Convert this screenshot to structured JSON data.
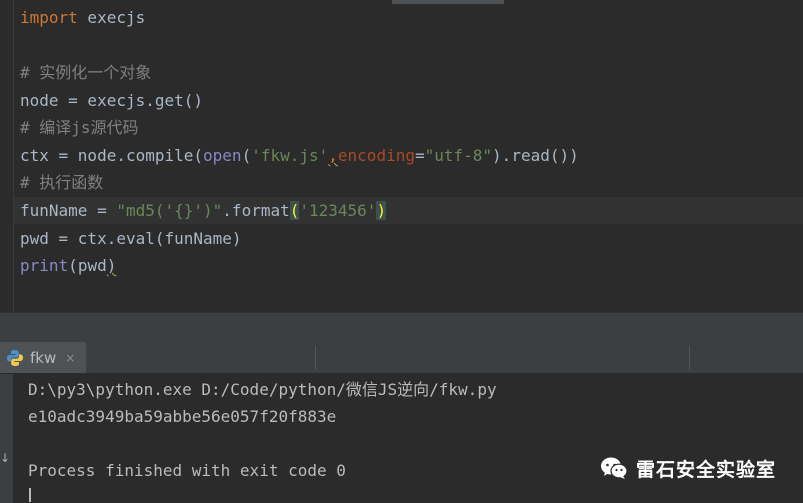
{
  "editor": {
    "lines": {
      "l1": {
        "keyword": "import",
        "rest": " execjs"
      },
      "l3": {
        "comment": "# 实例化一个对象"
      },
      "l4": {
        "text": "node = execjs.get()"
      },
      "l5": {
        "comment": "# 编译js源代码"
      },
      "l6": {
        "prefix": "ctx = node.compile(",
        "open_fn": "open",
        "paren": "(",
        "filename": "'fkw.js'",
        "comma": ",",
        "param": "encoding",
        "eq": "=",
        "encoding_value": "\"utf-8\"",
        "suffix": ").read())"
      },
      "l7": {
        "comment": "# 执行函数"
      },
      "l8": {
        "prefix": "funName = ",
        "template": "\"md5('{}')\"",
        "method": ".format",
        "open_paren": "(",
        "arg": "'123456'",
        "close_paren": ")"
      },
      "l9": {
        "text": "pwd = ctx.eval(funName)"
      },
      "l10": {
        "fn": "print",
        "open": "(",
        "arg": "pwd",
        "close": ")"
      }
    }
  },
  "run_panel": {
    "tab_label": "fkw",
    "close_glyph": "×",
    "icon": "python-icon"
  },
  "console": {
    "command": "D:\\py3\\python.exe D:/Code/python/微信JS逆向/fkw.py",
    "output": "e10adc3949ba59abbe56e057f20f883e",
    "exit_message": "Process finished with exit code 0",
    "side_arrow": "↓"
  },
  "watermark": {
    "icon": "wechat-icon",
    "text": "雷石安全实验室"
  },
  "colors": {
    "editor_bg": "#2b2b2b",
    "keyword": "#cc7832",
    "string": "#6a8759",
    "comment": "#808080",
    "builtin": "#8888c6",
    "param": "#aa4926",
    "text": "#a9b7c6"
  }
}
